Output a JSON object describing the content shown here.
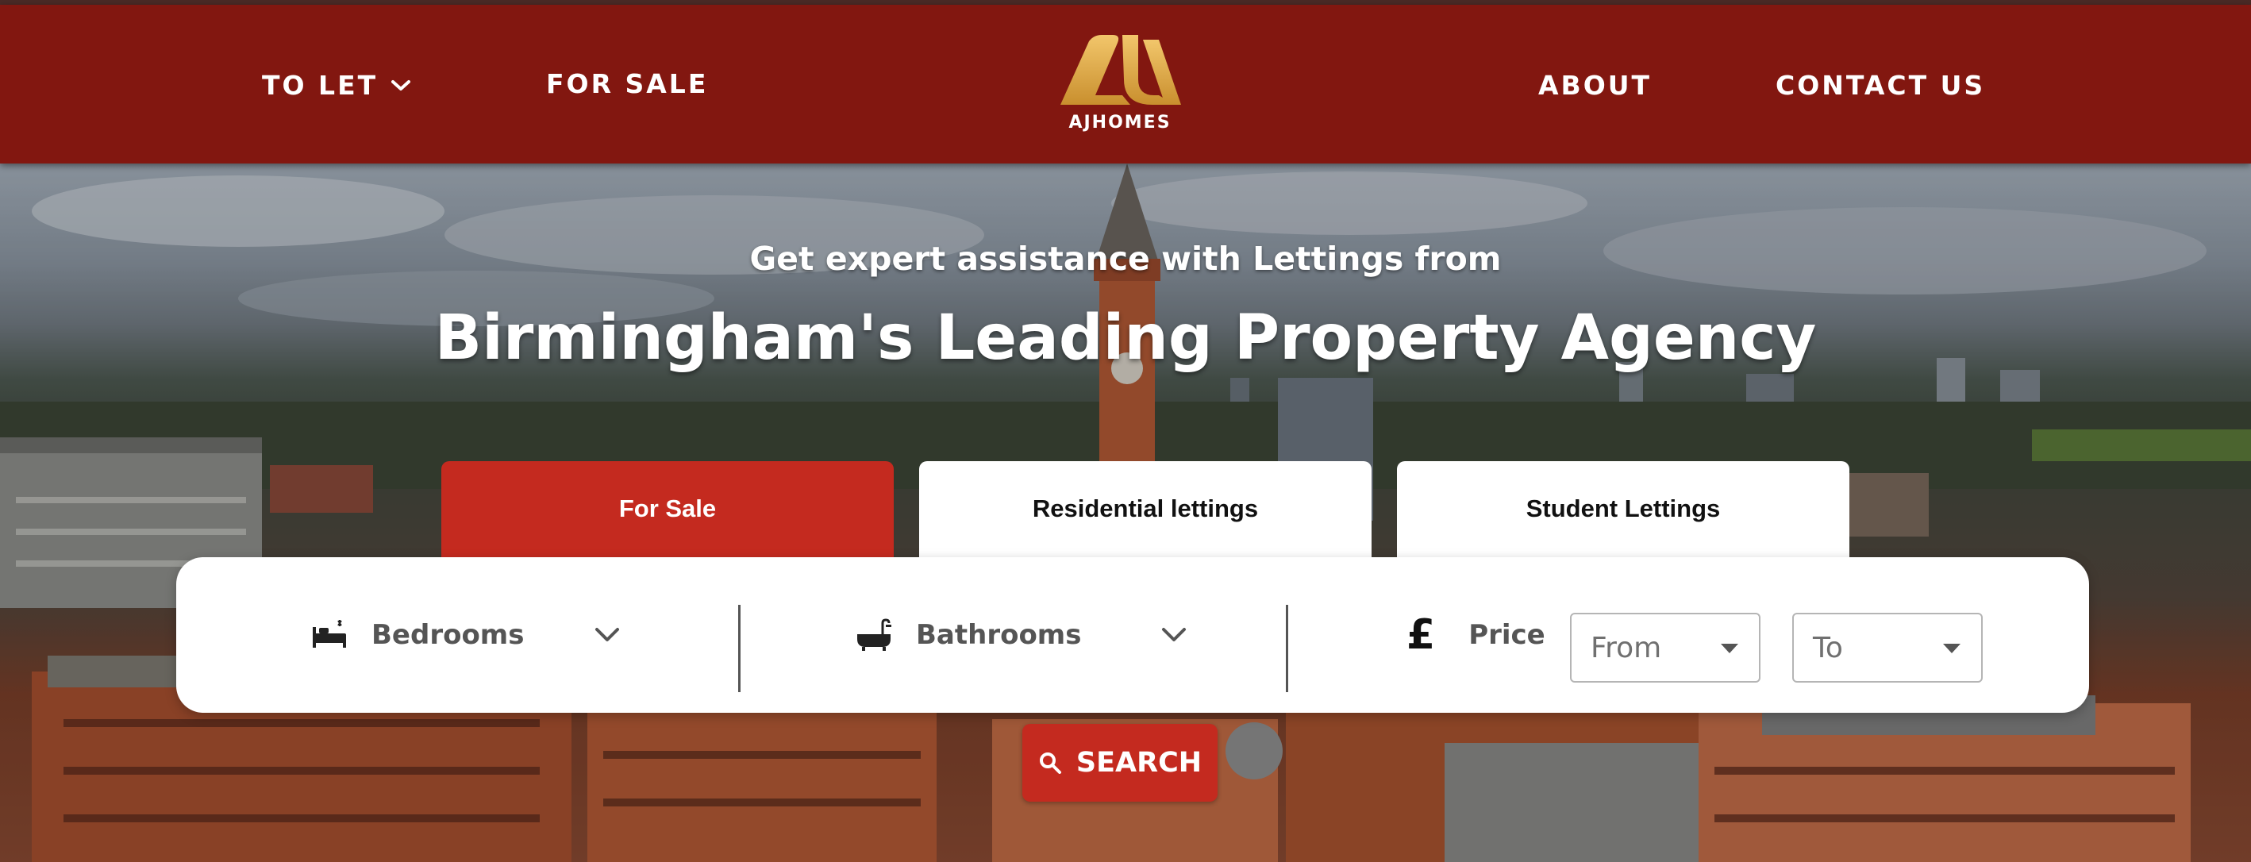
{
  "header": {
    "nav_left": [
      {
        "label": "TO LET",
        "has_dropdown": true
      },
      {
        "label": "FOR SALE",
        "has_dropdown": false
      }
    ],
    "nav_right": [
      {
        "label": "ABOUT"
      },
      {
        "label": "CONTACT US"
      }
    ],
    "logo_text": "AJHOMES",
    "background_color": "#821710"
  },
  "hero": {
    "subtitle": "Get expert assistance with  Lettings  from",
    "title": "Birmingham's Leading Property Agency"
  },
  "tabs": [
    {
      "label": "For Sale",
      "active": true
    },
    {
      "label": "Residential lettings",
      "active": false
    },
    {
      "label": "Student Lettings",
      "active": false
    }
  ],
  "search": {
    "bedrooms_label": "Bedrooms",
    "bathrooms_label": "Bathrooms",
    "price_symbol": "£",
    "price_label": "Price",
    "from_value": "From",
    "to_value": "To",
    "button_label": "SEARCH",
    "accent_color": "#c42a1f"
  },
  "icons": [
    "chevron-down-icon",
    "logo-icon",
    "bed-icon",
    "bath-icon",
    "pound-icon",
    "caret-down-icon",
    "search-icon"
  ]
}
